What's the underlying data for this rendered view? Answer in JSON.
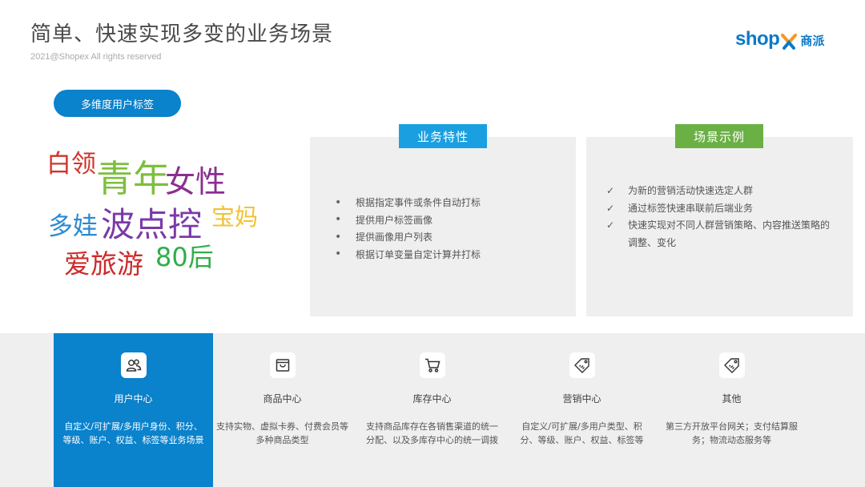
{
  "header": {
    "title": "简单、快速实现多变的业务场景",
    "copyright": "2021@Shopex All rights reserved",
    "logo_text_1": "shop",
    "logo_text_2": "商派"
  },
  "tag_button": "多维度用户标签",
  "word_cloud": [
    {
      "text": "白领",
      "color": "#d0342c"
    },
    {
      "text": "青年",
      "color": "#7dbf3e"
    },
    {
      "text": "女性",
      "color": "#8a2f8f"
    },
    {
      "text": "多娃",
      "color": "#2a8ad0"
    },
    {
      "text": "波点控",
      "color": "#7b3aa8"
    },
    {
      "text": "宝妈",
      "color": "#f1c232"
    },
    {
      "text": "爱旅游",
      "color": "#cc2b2b"
    },
    {
      "text": "80后",
      "color": "#2fae4a"
    }
  ],
  "features": {
    "heading": "业务特性",
    "items": [
      "根据指定事件或条件自动打标",
      "提供用户标签画像",
      "提供画像用户列表",
      "根据订单变量自定计算并打标"
    ]
  },
  "examples": {
    "heading": "场景示例",
    "items": [
      "为新的营销活动快速选定人群",
      "通过标签快速串联前后端业务",
      "快速实现对不同人群营销策略、内容推送策略的调整、变化"
    ]
  },
  "cards": [
    {
      "label": "用户中心",
      "desc": "自定义/可扩展/多用户身份、积分、等级、账户、权益、标签等业务场景",
      "icon": "users-icon"
    },
    {
      "label": "商品中心",
      "desc": "支持实物、虚拟卡券、付费会员等多种商品类型",
      "icon": "shopping-bag-icon"
    },
    {
      "label": "库存中心",
      "desc": "支持商品库存在各销售渠道的统一分配、以及多库存中心的统一调拨",
      "icon": "cart-icon"
    },
    {
      "label": "营销中心",
      "desc": "自定义/可扩展/多用户类型、积分、等级、账户、权益、标签等",
      "icon": "sale-tag-icon"
    },
    {
      "label": "其他",
      "desc": "第三方开放平台网关；支付结算服务；物流动态服务等",
      "icon": "sale-tag-icon"
    }
  ],
  "colors": {
    "primary_blue": "#0a82cc",
    "feature_blue": "#1aa0e0",
    "example_green": "#6bb045",
    "logo_orange": "#f39a1e"
  }
}
